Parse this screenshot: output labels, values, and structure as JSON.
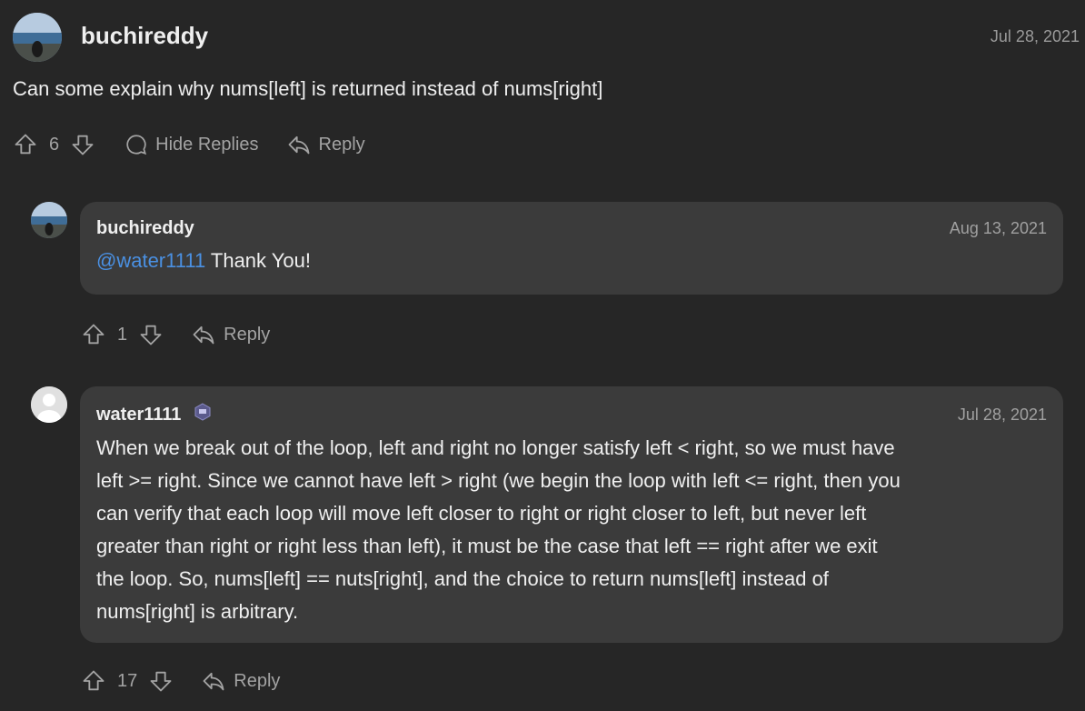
{
  "top_comment": {
    "author": "buchireddy",
    "date": "Jul 28, 2021",
    "body": "Can some explain why nums[left] is returned instead of nums[right]",
    "votes": "6",
    "hide_replies_label": "Hide Replies",
    "reply_label": "Reply"
  },
  "replies": [
    {
      "author": "buchireddy",
      "date": "Aug 13, 2021",
      "mention": "@water1111",
      "body": " Thank You!",
      "votes": "1",
      "reply_label": "Reply"
    },
    {
      "author": "water1111",
      "date": "Jul 28, 2021",
      "body_lines": [
        "When we break out of the loop, left and right no longer satisfy left < right, so we must have",
        "left >= right. Since we cannot have left > right (we begin the loop with left <= right, then you",
        "can verify that each loop will move left closer to right or right closer to left, but never left",
        "greater than right or right less than left), it must be the case that left == right after we exit",
        "the loop. So, nums[left] == nuts[right], and the choice to return nums[left] instead of",
        "nums[right] is arbitrary."
      ],
      "votes": "17",
      "reply_label": "Reply"
    }
  ],
  "colors": {
    "background": "#262626",
    "bubble": "#3b3b3b",
    "mention": "#4a90e2",
    "muted": "#a3a3a3"
  }
}
